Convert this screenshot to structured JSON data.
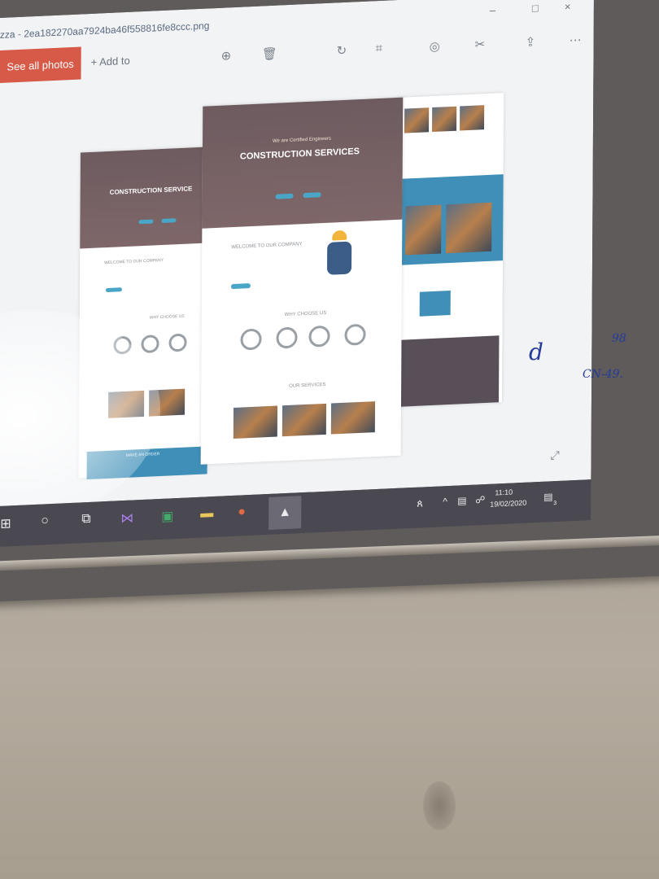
{
  "window": {
    "title": "zza - 2ea182270aa7924ba46f558816fe8ccc.png",
    "controls": [
      "–",
      "□",
      "×"
    ]
  },
  "commandbar": {
    "see_all": "See all photos",
    "add_to": "+ Add to",
    "tools": [
      "zoom-icon",
      "delete-icon",
      "rotate-icon",
      "crop-icon",
      "enhance-icon",
      "edit-icon",
      "share-icon",
      "more-icon"
    ]
  },
  "mockup": {
    "hero_kicker": "We are Certified Engineers",
    "hero_title": "CONSTRUCTION SERVICES",
    "hero_title_left": "CONSTRUCTION SERVICE",
    "welcome": "WELCOME TO OUR COMPANY",
    "why": "WHY CHOOSE US",
    "services": "OUR SERVICES",
    "contact_band": "MAKE AN ORDER"
  },
  "taskbar": {
    "apps": [
      "start-icon",
      "cortana-icon",
      "task-view-icon",
      "visual-studio-icon",
      "excel-icon",
      "file-explorer-icon",
      "powerpoint-icon",
      "photos-icon"
    ],
    "time": "11:10",
    "date": "19/02/2020",
    "notification_count": "3"
  },
  "whiteboard": {
    "ink_1": "d",
    "ink_2": "98",
    "ink_3": "CN-49."
  }
}
